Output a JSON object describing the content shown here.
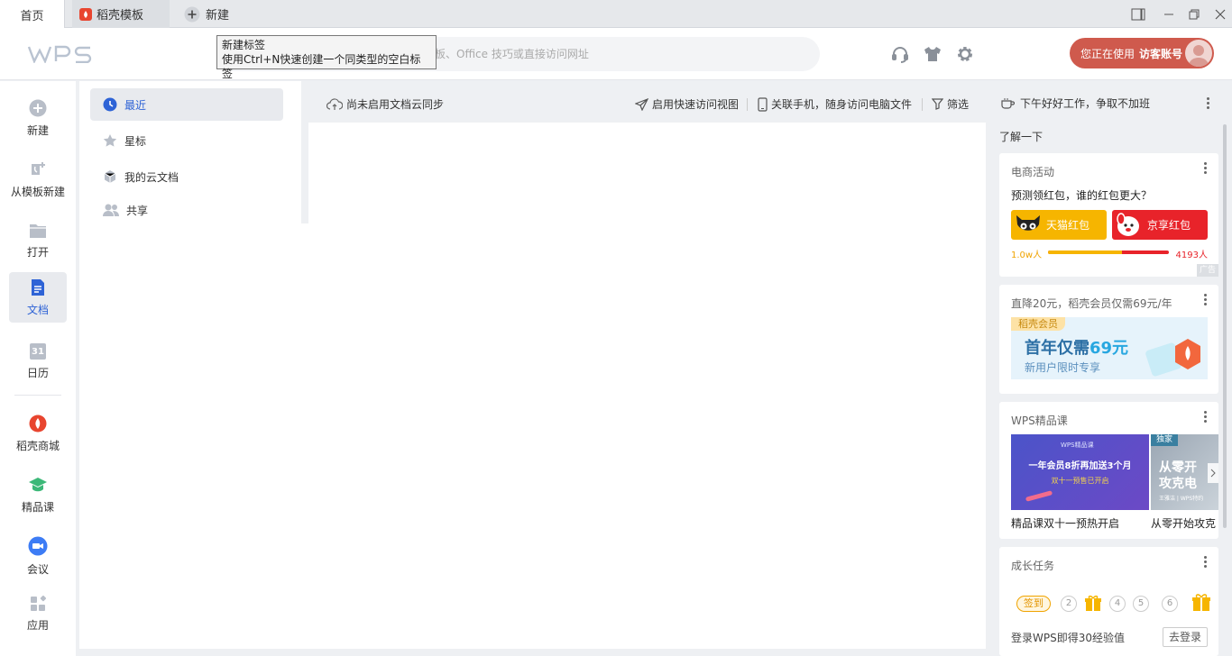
{
  "tabs": {
    "home": "首页",
    "docer": "稻壳模板",
    "new": "新建"
  },
  "search": {
    "placeholder": "板、Office 技巧或直接访问网址"
  },
  "tooltip": {
    "line1": "新建标签",
    "line2": "使用Ctrl+N快速创建一个同类型的空白标签"
  },
  "user": {
    "prefix": "您正在使用",
    "account": "访客账号"
  },
  "left_nav": [
    {
      "label": "新建",
      "icon": "plus-circle-icon"
    },
    {
      "label": "从模板新建",
      "icon": "template-icon"
    },
    {
      "label": "打开",
      "icon": "folder-icon"
    },
    {
      "label": "文档",
      "icon": "document-icon"
    },
    {
      "label": "日历",
      "icon": "calendar-icon"
    },
    {
      "label": "稻壳商城",
      "icon": "docer-store-icon"
    },
    {
      "label": "精品课",
      "icon": "course-icon"
    },
    {
      "label": "会议",
      "icon": "meeting-icon"
    },
    {
      "label": "应用",
      "icon": "apps-icon"
    }
  ],
  "calendar_day": "31",
  "sub_nav": [
    {
      "label": "最近"
    },
    {
      "label": "星标"
    },
    {
      "label": "我的云文档"
    },
    {
      "label": "共享"
    }
  ],
  "toolbar": {
    "cloud_sync": "尚未启用文档云同步",
    "quick_view": "启用快速访问视图",
    "phone": "关联手机，随身访问电脑文件",
    "filter": "筛选"
  },
  "right": {
    "greeting": "下午好好工作，争取不加班",
    "section_title": "了解一下",
    "ecommerce": {
      "title": "电商活动",
      "question": "预测领红包，谁的红包更大？",
      "tmall": "天猫红包",
      "jd": "京享红包",
      "left_count": "1.0w人",
      "right_count": "4193人",
      "ad": "广告",
      "share_left": 0.61
    },
    "docer_vip": {
      "title": "直降20元，稻壳会员仅需69元/年",
      "tag": "稻壳会员",
      "headline_a": "首年仅需",
      "headline_b": "69元",
      "sub": "新用户限时专享"
    },
    "course": {
      "title": "WPS精品课",
      "banner_brand": "WPS精品课",
      "banner_main": "一年会员8折再加送3个月",
      "banner_sub": "双十一预售已开启",
      "badge": "独家",
      "banner2_line1": "从零开",
      "banner2_line2": "攻克电",
      "banner2_small": "王雅洁 | WPS特约",
      "caption1": "精品课双十一预热开启",
      "caption2": "从零开始攻克"
    },
    "growth": {
      "title": "成长任务",
      "checkin": "签到",
      "days": [
        "2",
        "4",
        "5",
        "6"
      ],
      "login_text": "登录WPS即得30经验值",
      "login_btn": "去登录"
    }
  },
  "colors": {
    "accent": "#2e63d6",
    "user_bg": "#cf5a4d",
    "tmall": "#f6b500",
    "jd": "#e8232a"
  }
}
